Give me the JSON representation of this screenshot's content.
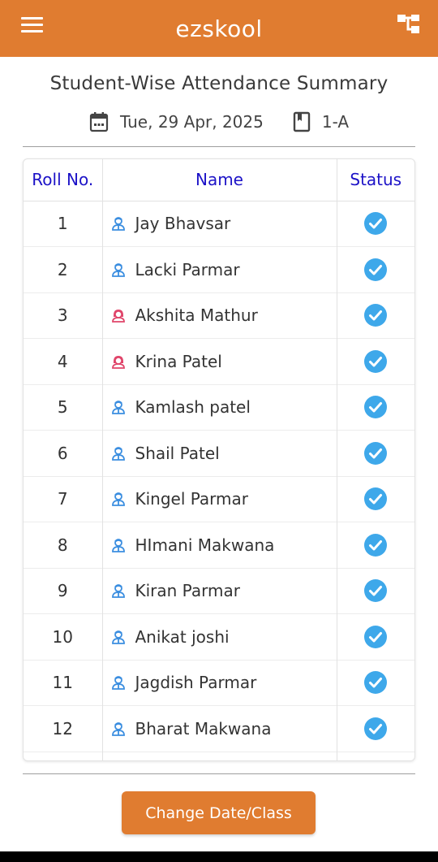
{
  "app": {
    "title": "ezskool",
    "brand_color": "#e07c30"
  },
  "icons": {
    "menu": "hamburger-menu-icon",
    "hierarchy": "hierarchy-icon",
    "calendar": "calendar-icon",
    "book": "book-icon",
    "student": "student-icon",
    "status": "check-circle-icon"
  },
  "summary": {
    "heading": "Student-Wise Attendance Summary",
    "date": "Tue, 29 Apr, 2025",
    "class": "1-A"
  },
  "table": {
    "headers": {
      "roll": "Roll No.",
      "name": "Name",
      "status": "Status"
    },
    "header_color": "#1c12c7",
    "rows": [
      {
        "roll": "1",
        "name": "Jay Bhavsar",
        "gender": "male",
        "status": "present"
      },
      {
        "roll": "2",
        "name": "Lacki Parmar",
        "gender": "male",
        "status": "present"
      },
      {
        "roll": "3",
        "name": "Akshita Mathur",
        "gender": "female",
        "status": "present"
      },
      {
        "roll": "4",
        "name": "Krina Patel",
        "gender": "female",
        "status": "present"
      },
      {
        "roll": "5",
        "name": "Kamlash patel",
        "gender": "male",
        "status": "present"
      },
      {
        "roll": "6",
        "name": "Shail Patel",
        "gender": "male",
        "status": "present"
      },
      {
        "roll": "7",
        "name": "Kingel Parmar",
        "gender": "male",
        "status": "present"
      },
      {
        "roll": "8",
        "name": "HImani Makwana",
        "gender": "male",
        "status": "present"
      },
      {
        "roll": "9",
        "name": "Kiran Parmar",
        "gender": "male",
        "status": "present"
      },
      {
        "roll": "10",
        "name": "Anikat joshi",
        "gender": "male",
        "status": "present"
      },
      {
        "roll": "11",
        "name": "Jagdish Parmar",
        "gender": "male",
        "status": "present"
      },
      {
        "roll": "12",
        "name": "Bharat Makwana",
        "gender": "male",
        "status": "present"
      },
      {
        "roll": "",
        "name": "",
        "gender": "",
        "status": ""
      }
    ]
  },
  "colors": {
    "male_icon": "#3b8ee0",
    "female_icon": "#e0456a",
    "check": "#3ea8ea"
  },
  "actions": {
    "change_label": "Change Date/Class"
  }
}
